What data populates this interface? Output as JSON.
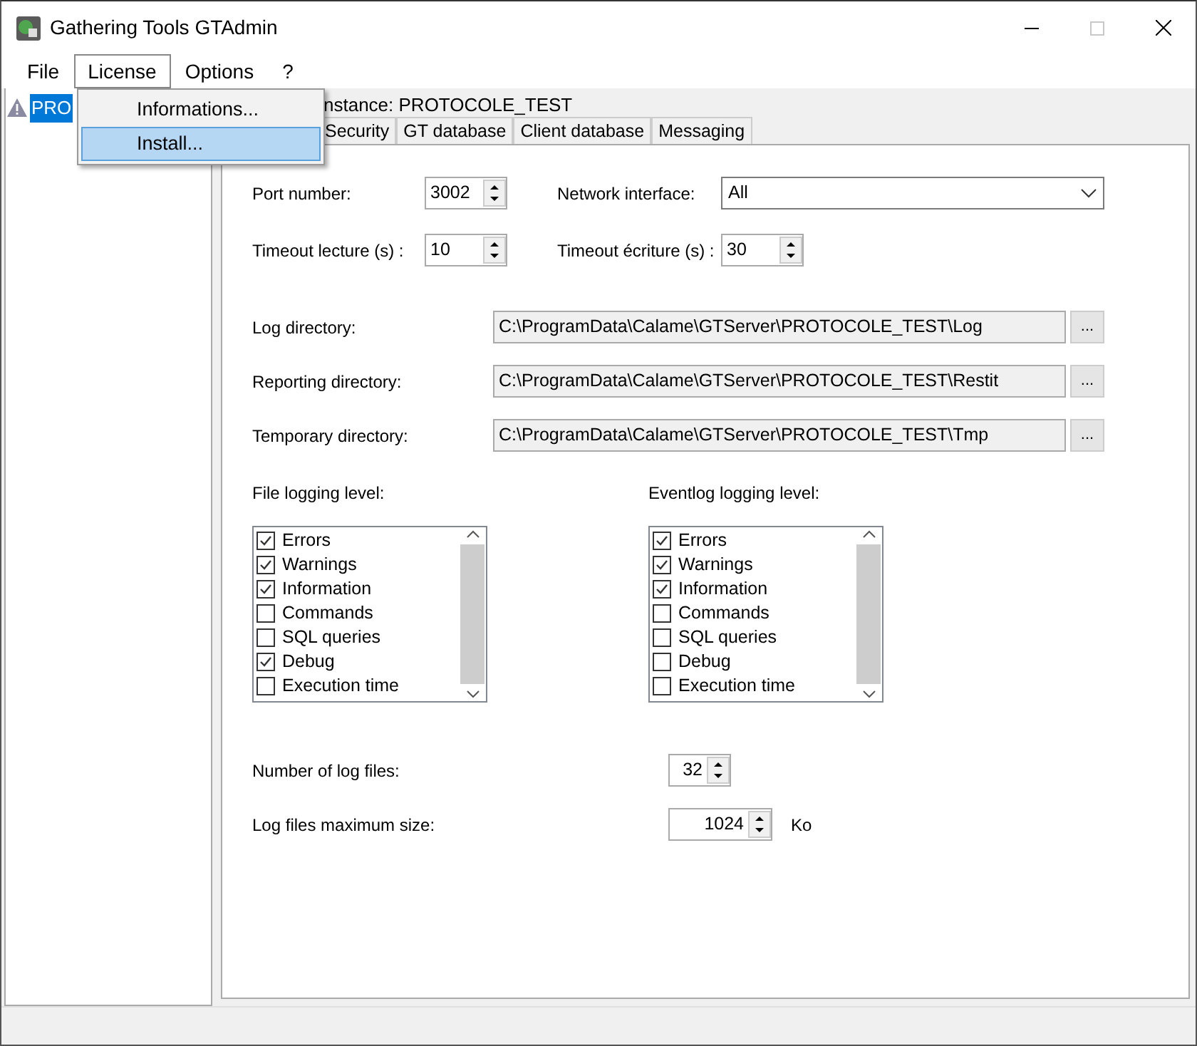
{
  "window": {
    "title": "Gathering Tools GTAdmin",
    "maximize_disabled": true
  },
  "menu": [
    {
      "label": "File",
      "selected": false
    },
    {
      "label": "License",
      "selected": true
    },
    {
      "label": "Options",
      "selected": false
    },
    {
      "label": "?",
      "selected": false
    }
  ],
  "dropdown": [
    {
      "label": "Informations...",
      "selected": false
    },
    {
      "label": "Install...",
      "selected": true
    }
  ],
  "tree": [
    {
      "label": "PRO",
      "selected": true
    }
  ],
  "group_title": "nstance: PROTOCOLE_TEST",
  "tabs": [
    {
      "label": "Security",
      "selected": false
    },
    {
      "label": "GT database",
      "selected": false
    },
    {
      "label": "Client database",
      "selected": false
    },
    {
      "label": "Messaging",
      "selected": false
    }
  ],
  "port_number": {
    "label": "Port number:",
    "value": "3002"
  },
  "network_interface": {
    "label": "Network interface:",
    "value": "All"
  },
  "timeout_read": {
    "label": "Timeout lecture (s) :",
    "value": "10"
  },
  "timeout_write": {
    "label": "Timeout écriture (s) :",
    "value": "30"
  },
  "directories": [
    {
      "label": "Log directory:",
      "value": "C:\\ProgramData\\Calame\\GTServer\\PROTOCOLE_TEST\\Log",
      "button": "..."
    },
    {
      "label": "Reporting directory:",
      "value": "C:\\ProgramData\\Calame\\GTServer\\PROTOCOLE_TEST\\Restit",
      "button": "..."
    },
    {
      "label": "Temporary directory:",
      "value": "C:\\ProgramData\\Calame\\GTServer\\PROTOCOLE_TEST\\Tmp",
      "button": "..."
    }
  ],
  "logging_lists": [
    {
      "label": "File logging level:",
      "items": [
        {
          "label": "Errors",
          "checked": true
        },
        {
          "label": "Warnings",
          "checked": true
        },
        {
          "label": "Information",
          "checked": true
        },
        {
          "label": "Commands",
          "checked": false
        },
        {
          "label": "SQL queries",
          "checked": false
        },
        {
          "label": "Debug",
          "checked": true
        },
        {
          "label": "Execution time",
          "checked": false
        }
      ]
    },
    {
      "label": "Eventlog logging level:",
      "items": [
        {
          "label": "Errors",
          "checked": true
        },
        {
          "label": "Warnings",
          "checked": true
        },
        {
          "label": "Information",
          "checked": true
        },
        {
          "label": "Commands",
          "checked": false
        },
        {
          "label": "SQL queries",
          "checked": false
        },
        {
          "label": "Debug",
          "checked": false
        },
        {
          "label": "Execution time",
          "checked": false
        }
      ]
    }
  ],
  "log_file_count": {
    "label": "Number of log files:",
    "value": "32"
  },
  "log_file_size": {
    "label": "Log files maximum size:",
    "value": "1024",
    "unit": "Ko"
  }
}
